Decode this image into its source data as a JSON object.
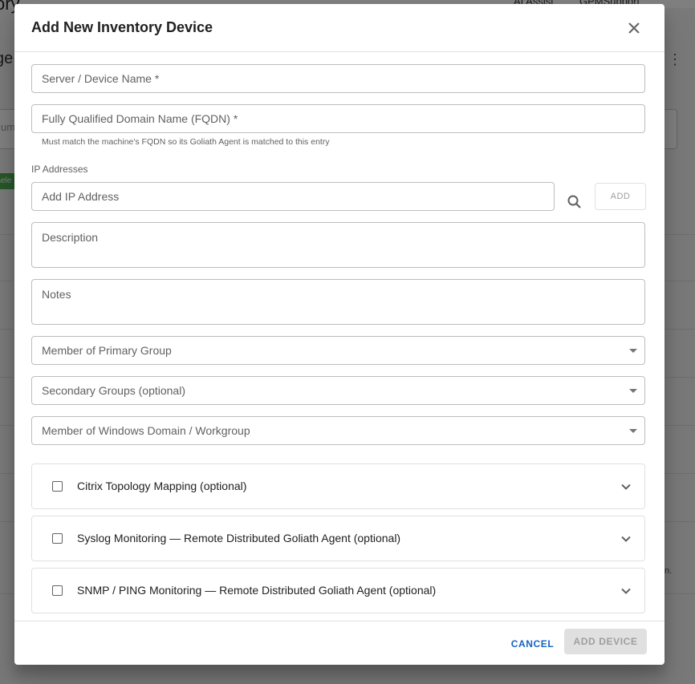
{
  "background": {
    "title": "ory",
    "ai_assist": "AI Assist",
    "user": "GPMSupport",
    "heading": "ge",
    "search_stub": "um",
    "chip": "sele",
    "note": "n."
  },
  "dialog": {
    "title": "Add New Inventory Device",
    "fields": {
      "server_name": "Server / Device Name *",
      "fqdn": "Fully Qualified Domain Name (FQDN) *",
      "fqdn_helper": "Must match the machine's FQDN so its Goliath Agent is matched to this entry",
      "ip_section_label": "IP Addresses",
      "ip_placeholder": "Add IP Address",
      "ip_add_label": "ADD",
      "description": "Description",
      "notes": "Notes",
      "primary_group": "Member of Primary Group",
      "secondary_groups": "Secondary Groups (optional)",
      "windows_domain": "Member of Windows Domain / Workgroup"
    },
    "accordions": [
      {
        "label": "Citrix Topology Mapping (optional)"
      },
      {
        "label": "Syslog Monitoring — Remote Distributed Goliath Agent (optional)"
      },
      {
        "label": "SNMP / PING Monitoring — Remote Distributed Goliath Agent (optional)"
      }
    ],
    "footer": {
      "cancel": "CANCEL",
      "add_device": "ADD DEVICE"
    }
  },
  "colors": {
    "accent": "#1565c0",
    "overlay": "rgba(0,0,0,0.5)",
    "disabled": "#9e9e9e"
  }
}
